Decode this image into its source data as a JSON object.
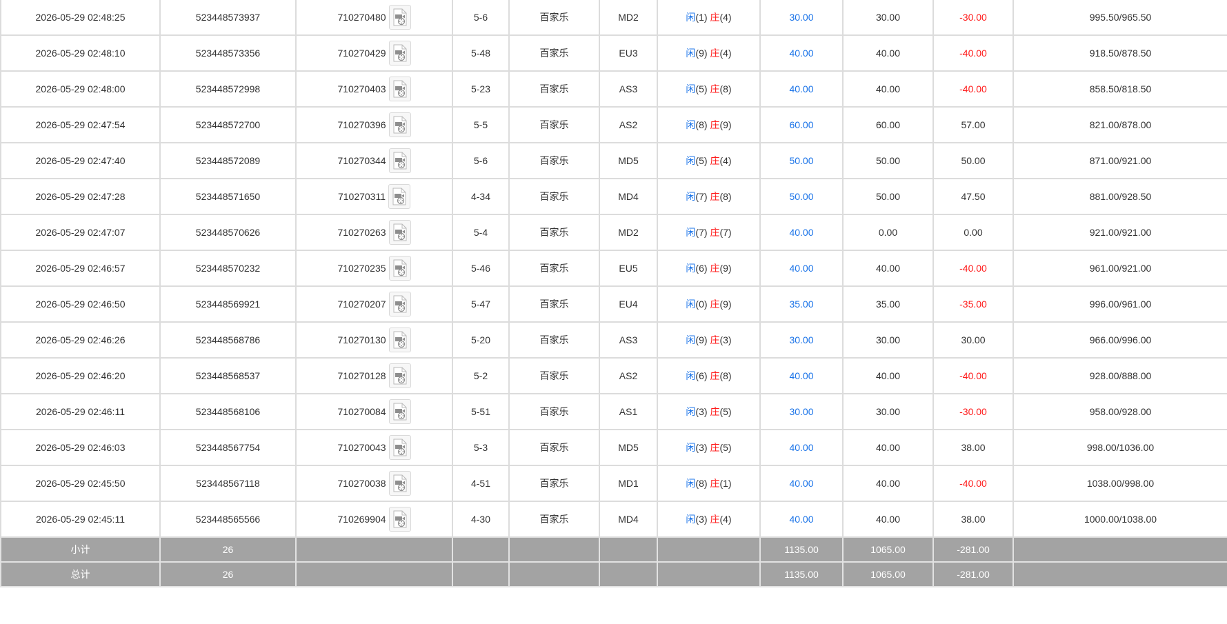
{
  "colors": {
    "player": "#1a73e8",
    "banker": "#ff1a1a",
    "bet": "#1a73e8",
    "loss": "#ff1a1a",
    "footer_bg": "#a3a3a3",
    "border": "#dcdcdc"
  },
  "icons": {
    "replay": "video-replay-icon"
  },
  "rows": [
    {
      "time": "2026-05-29 02:48:25",
      "bet_no": "523448573937",
      "round_no": "710270480",
      "shoe": "5-6",
      "game": "百家乐",
      "table": "MD2",
      "player_label": "闲",
      "player_pts": "(1)",
      "banker_label": "庄",
      "banker_pts": "(4)",
      "bet": "30.00",
      "valid": "30.00",
      "winloss": "-30.00",
      "neg": true,
      "balance": "995.50/965.50"
    },
    {
      "time": "2026-05-29 02:48:10",
      "bet_no": "523448573356",
      "round_no": "710270429",
      "shoe": "5-48",
      "game": "百家乐",
      "table": "EU3",
      "player_label": "闲",
      "player_pts": "(9)",
      "banker_label": "庄",
      "banker_pts": "(4)",
      "bet": "40.00",
      "valid": "40.00",
      "winloss": "-40.00",
      "neg": true,
      "balance": "918.50/878.50"
    },
    {
      "time": "2026-05-29 02:48:00",
      "bet_no": "523448572998",
      "round_no": "710270403",
      "shoe": "5-23",
      "game": "百家乐",
      "table": "AS3",
      "player_label": "闲",
      "player_pts": "(5)",
      "banker_label": "庄",
      "banker_pts": "(8)",
      "bet": "40.00",
      "valid": "40.00",
      "winloss": "-40.00",
      "neg": true,
      "balance": "858.50/818.50"
    },
    {
      "time": "2026-05-29 02:47:54",
      "bet_no": "523448572700",
      "round_no": "710270396",
      "shoe": "5-5",
      "game": "百家乐",
      "table": "AS2",
      "player_label": "闲",
      "player_pts": "(8)",
      "banker_label": "庄",
      "banker_pts": "(9)",
      "bet": "60.00",
      "valid": "60.00",
      "winloss": "57.00",
      "neg": false,
      "balance": "821.00/878.00"
    },
    {
      "time": "2026-05-29 02:47:40",
      "bet_no": "523448572089",
      "round_no": "710270344",
      "shoe": "5-6",
      "game": "百家乐",
      "table": "MD5",
      "player_label": "闲",
      "player_pts": "(5)",
      "banker_label": "庄",
      "banker_pts": "(4)",
      "bet": "50.00",
      "valid": "50.00",
      "winloss": "50.00",
      "neg": false,
      "balance": "871.00/921.00"
    },
    {
      "time": "2026-05-29 02:47:28",
      "bet_no": "523448571650",
      "round_no": "710270311",
      "shoe": "4-34",
      "game": "百家乐",
      "table": "MD4",
      "player_label": "闲",
      "player_pts": "(7)",
      "banker_label": "庄",
      "banker_pts": "(8)",
      "bet": "50.00",
      "valid": "50.00",
      "winloss": "47.50",
      "neg": false,
      "balance": "881.00/928.50"
    },
    {
      "time": "2026-05-29 02:47:07",
      "bet_no": "523448570626",
      "round_no": "710270263",
      "shoe": "5-4",
      "game": "百家乐",
      "table": "MD2",
      "player_label": "闲",
      "player_pts": "(7)",
      "banker_label": "庄",
      "banker_pts": "(7)",
      "bet": "40.00",
      "valid": "0.00",
      "winloss": "0.00",
      "neg": false,
      "balance": "921.00/921.00"
    },
    {
      "time": "2026-05-29 02:46:57",
      "bet_no": "523448570232",
      "round_no": "710270235",
      "shoe": "5-46",
      "game": "百家乐",
      "table": "EU5",
      "player_label": "闲",
      "player_pts": "(6)",
      "banker_label": "庄",
      "banker_pts": "(9)",
      "bet": "40.00",
      "valid": "40.00",
      "winloss": "-40.00",
      "neg": true,
      "balance": "961.00/921.00"
    },
    {
      "time": "2026-05-29 02:46:50",
      "bet_no": "523448569921",
      "round_no": "710270207",
      "shoe": "5-47",
      "game": "百家乐",
      "table": "EU4",
      "player_label": "闲",
      "player_pts": "(0)",
      "banker_label": "庄",
      "banker_pts": "(9)",
      "bet": "35.00",
      "valid": "35.00",
      "winloss": "-35.00",
      "neg": true,
      "balance": "996.00/961.00"
    },
    {
      "time": "2026-05-29 02:46:26",
      "bet_no": "523448568786",
      "round_no": "710270130",
      "shoe": "5-20",
      "game": "百家乐",
      "table": "AS3",
      "player_label": "闲",
      "player_pts": "(9)",
      "banker_label": "庄",
      "banker_pts": "(3)",
      "bet": "30.00",
      "valid": "30.00",
      "winloss": "30.00",
      "neg": false,
      "balance": "966.00/996.00"
    },
    {
      "time": "2026-05-29 02:46:20",
      "bet_no": "523448568537",
      "round_no": "710270128",
      "shoe": "5-2",
      "game": "百家乐",
      "table": "AS2",
      "player_label": "闲",
      "player_pts": "(6)",
      "banker_label": "庄",
      "banker_pts": "(8)",
      "bet": "40.00",
      "valid": "40.00",
      "winloss": "-40.00",
      "neg": true,
      "balance": "928.00/888.00"
    },
    {
      "time": "2026-05-29 02:46:11",
      "bet_no": "523448568106",
      "round_no": "710270084",
      "shoe": "5-51",
      "game": "百家乐",
      "table": "AS1",
      "player_label": "闲",
      "player_pts": "(3)",
      "banker_label": "庄",
      "banker_pts": "(5)",
      "bet": "30.00",
      "valid": "30.00",
      "winloss": "-30.00",
      "neg": true,
      "balance": "958.00/928.00"
    },
    {
      "time": "2026-05-29 02:46:03",
      "bet_no": "523448567754",
      "round_no": "710270043",
      "shoe": "5-3",
      "game": "百家乐",
      "table": "MD5",
      "player_label": "闲",
      "player_pts": "(3)",
      "banker_label": "庄",
      "banker_pts": "(5)",
      "bet": "40.00",
      "valid": "40.00",
      "winloss": "38.00",
      "neg": false,
      "balance": "998.00/1036.00"
    },
    {
      "time": "2026-05-29 02:45:50",
      "bet_no": "523448567118",
      "round_no": "710270038",
      "shoe": "4-51",
      "game": "百家乐",
      "table": "MD1",
      "player_label": "闲",
      "player_pts": "(8)",
      "banker_label": "庄",
      "banker_pts": "(1)",
      "bet": "40.00",
      "valid": "40.00",
      "winloss": "-40.00",
      "neg": true,
      "balance": "1038.00/998.00"
    },
    {
      "time": "2026-05-29 02:45:11",
      "bet_no": "523448565566",
      "round_no": "710269904",
      "shoe": "4-30",
      "game": "百家乐",
      "table": "MD4",
      "player_label": "闲",
      "player_pts": "(3)",
      "banker_label": "庄",
      "banker_pts": "(4)",
      "bet": "40.00",
      "valid": "40.00",
      "winloss": "38.00",
      "neg": false,
      "balance": "1000.00/1038.00"
    }
  ],
  "subtotal": {
    "label": "小计",
    "count": "26",
    "bet": "1135.00",
    "valid": "1065.00",
    "winloss": "-281.00"
  },
  "total": {
    "label": "总计",
    "count": "26",
    "bet": "1135.00",
    "valid": "1065.00",
    "winloss": "-281.00"
  }
}
